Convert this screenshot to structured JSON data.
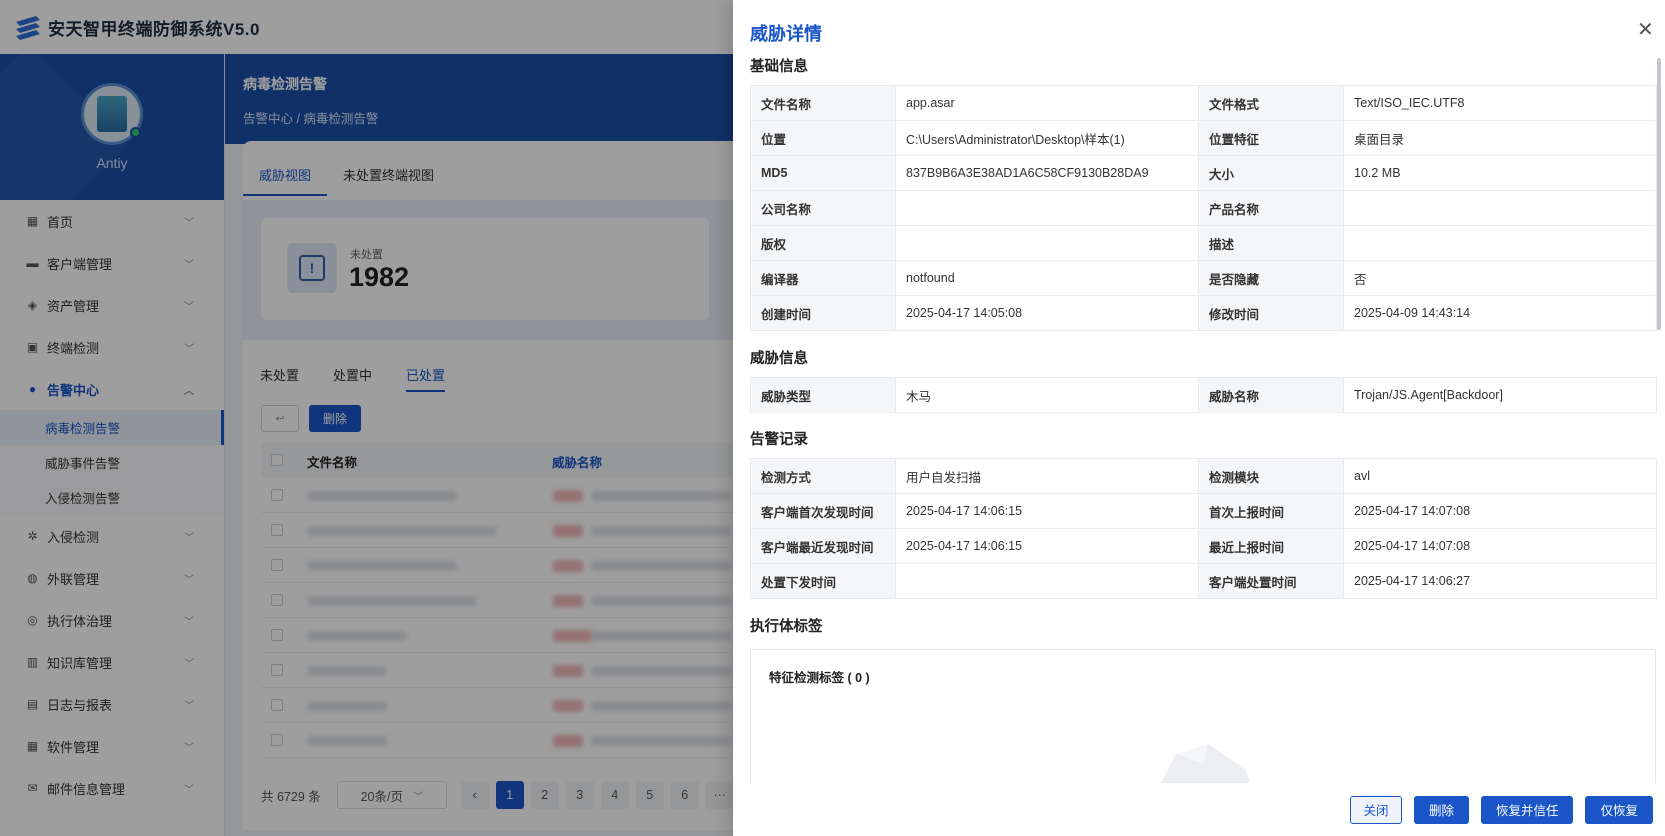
{
  "app": {
    "title": "安天智甲终端防御系统V5.0"
  },
  "profile": {
    "name": "Antiy"
  },
  "sidebar": {
    "items": [
      {
        "label": "首页",
        "icon": "dashboard-icon"
      },
      {
        "label": "客户端管理",
        "icon": "client-icon"
      },
      {
        "label": "资产管理",
        "icon": "asset-icon"
      },
      {
        "label": "终端检测",
        "icon": "terminal-icon"
      },
      {
        "label": "告警中心",
        "icon": "bell-icon",
        "active": true
      },
      {
        "label": "入侵检测",
        "icon": "intrusion-icon"
      },
      {
        "label": "外联管理",
        "icon": "globe-icon"
      },
      {
        "label": "执行体治理",
        "icon": "target-icon"
      },
      {
        "label": "知识库管理",
        "icon": "book-icon"
      },
      {
        "label": "日志与报表",
        "icon": "log-icon"
      },
      {
        "label": "软件管理",
        "icon": "software-icon"
      },
      {
        "label": "邮件信息管理",
        "icon": "mail-icon"
      }
    ],
    "alert_submenu": [
      "病毒检测告警",
      "威胁事件告警",
      "入侵检测告警"
    ]
  },
  "main": {
    "title": "病毒检测告警",
    "breadcrumb": "告警中心 / 病毒检测告警",
    "view_tabs": [
      "威胁视图",
      "未处置终端视图"
    ],
    "stat": {
      "label": "未处置",
      "value": "1982"
    },
    "status_tabs": [
      "未处置",
      "处置中",
      "已处置"
    ],
    "delete_label": "删除",
    "columns": {
      "file": "文件名称",
      "threat": "威胁名称"
    },
    "pager": {
      "total": "共 6729 条",
      "page_size": "20条/页",
      "pages": [
        "1",
        "2",
        "3",
        "4",
        "5",
        "6"
      ],
      "more": "···"
    }
  },
  "drawer": {
    "title": "威胁详情",
    "basic": {
      "title": "基础信息",
      "rows": [
        [
          "文件名称",
          "app.asar",
          "文件格式",
          "Text/ISO_IEC.UTF8"
        ],
        [
          "位置",
          "C:\\Users\\Administrator\\Desktop\\样本(1)",
          "位置特征",
          "桌面目录"
        ],
        [
          "MD5",
          "837B9B6A3E38AD1A6C58CF9130B28DA9",
          "大小",
          "10.2 MB"
        ],
        [
          "公司名称",
          "",
          "产品名称",
          ""
        ],
        [
          "版权",
          "",
          "描述",
          ""
        ],
        [
          "编译器",
          "notfound",
          "是否隐藏",
          "否"
        ],
        [
          "创建时间",
          "2025-04-17 14:05:08",
          "修改时间",
          "2025-04-09 14:43:14"
        ]
      ]
    },
    "threat": {
      "title": "威胁信息",
      "rows": [
        [
          "威胁类型",
          "木马",
          "威胁名称",
          "Trojan/JS.Agent[Backdoor]"
        ]
      ]
    },
    "alert": {
      "title": "告警记录",
      "rows": [
        [
          "检测方式",
          "用户自发扫描",
          "检测模块",
          "avl"
        ],
        [
          "客户端首次发现时间",
          "2025-04-17 14:06:15",
          "首次上报时间",
          "2025-04-17 14:07:08"
        ],
        [
          "客户端最近发现时间",
          "2025-04-17 14:06:15",
          "最近上报时间",
          "2025-04-17 14:07:08"
        ],
        [
          "处置下发时间",
          "",
          "客户端处置时间",
          "2025-04-17 14:06:27"
        ]
      ]
    },
    "tags": {
      "title": "执行体标签",
      "box_title": "特征检测标签 ( 0 )"
    },
    "footer": {
      "close": "关闭",
      "delete": "删除",
      "restore_trust": "恢复并信任",
      "restore_only": "仅恢复"
    }
  },
  "colors": {
    "primary": "#1a56c8",
    "header_blue": "#1a4ea8"
  }
}
